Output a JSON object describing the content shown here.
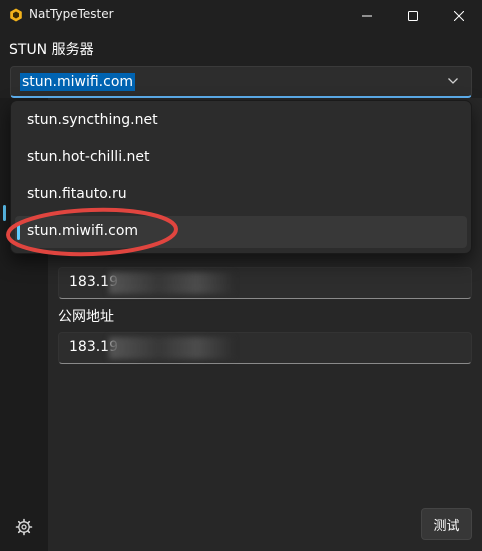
{
  "window": {
    "title": "NatTypeTester",
    "icon": "hexagon-app-icon",
    "controls": [
      "minimize-icon",
      "maximize-icon",
      "close-icon"
    ]
  },
  "stun_section": {
    "label": "STUN 服务器",
    "selected_value": "stun.miwifi.com",
    "options": [
      "stun.syncthing.net",
      "stun.hot-chilli.net",
      "stun.fitauto.ru",
      "stun.miwifi.com"
    ],
    "selected_index": 3
  },
  "fields": {
    "local_address_value": "183.19",
    "public_address_label": "公网地址",
    "public_address_value": "183.19"
  },
  "actions": {
    "test_label": "测试"
  },
  "colors": {
    "accent": "#60cdff",
    "selection": "#0063b1",
    "annotation": "#e0453f",
    "background": "#202020"
  }
}
